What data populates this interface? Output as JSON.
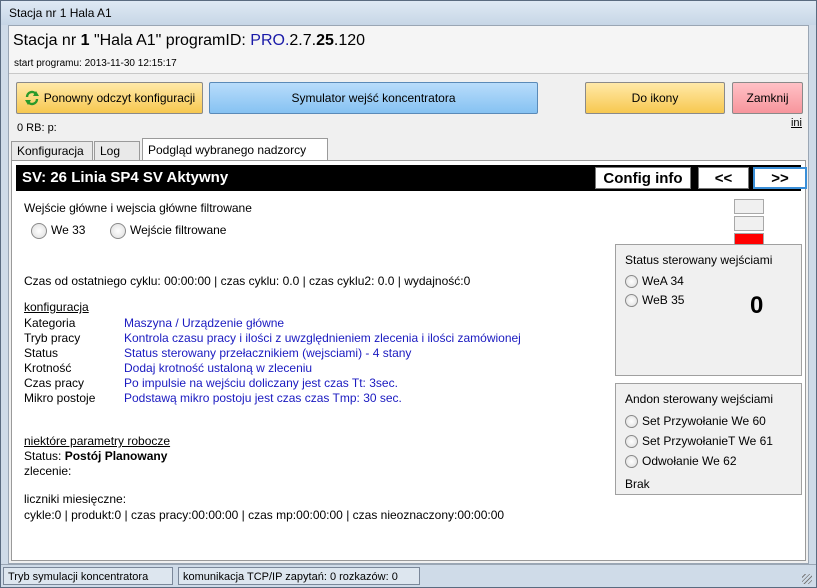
{
  "window": {
    "title": "Stacja nr 1   Hala A1"
  },
  "header": {
    "stacja_prefix": "Stacja nr ",
    "stacja_num": "1",
    "hala": "  \"Hala A1\"   programID: ",
    "pro": "PRO.",
    "ver1": "2.7.",
    "ver2": "25",
    "ver3": ".120",
    "start": "start programu: 2013-11-30 12:15:17"
  },
  "buttons": {
    "reload": "Ponowny odczyt konfiguracji",
    "simulator": "Symulator wejść koncentratora",
    "to_icon": "Do ikony",
    "close": "Zamknij"
  },
  "rb_line": "0   RB:  p:",
  "ini_link": "ini",
  "tabs": [
    "Konfiguracja",
    "Log",
    "Podgląd wybranego nadzorcy"
  ],
  "sv": {
    "title": "SV: 26 Linia SP4   SV Aktywny",
    "config_info": "Config info",
    "prev": "<<",
    "next": ">>"
  },
  "inputs": {
    "heading": "Wejście główne i wejscia główne filtrowane",
    "we": "We 33",
    "filtered": "Wejście filtrowane"
  },
  "indicators": {
    "colors": [
      "#f0f0f0",
      "#f0f0f0",
      "#ff0000"
    ]
  },
  "cycle_line": "Czas od ostatniego cyklu: 00:00:00 | czas cyklu: 0.0 | czas cyklu2: 0.0  |  wydajność:0",
  "konfiguracja": {
    "heading": "konfiguracja",
    "rows": [
      {
        "label": "Kategoria",
        "value": "Maszyna / Urządzenie główne"
      },
      {
        "label": "Tryb pracy",
        "value": "Kontrola czasu pracy i ilości z uwzględnieniem  zlecenia i ilości zamówionej"
      },
      {
        "label": "Status",
        "value": "Status sterowany przełacznikiem (wejsciami) - 4 stany"
      },
      {
        "label": "Krotność",
        "value": "Dodaj krotność ustaloną w zleceniu"
      },
      {
        "label": "Czas pracy",
        "value": "Po impulsie na wejściu doliczany jest czas Tt: 3sec."
      },
      {
        "label": "Mikro postoje",
        "value": "Podstawą mikro postoju jest czas czas Tmp: 30 sec."
      }
    ]
  },
  "params": {
    "heading": "niektóre parametry robocze",
    "status_label": "Status: ",
    "status_value": "Postój Planowany",
    "zlecenie": "zlecenie:"
  },
  "liczniki": {
    "heading": "liczniki miesięczne:",
    "line": "cykle:0  |  produkt:0  |  czas pracy:00:00:00  |  czas mp:00:00:00  |  czas nieoznaczony:00:00:00"
  },
  "status_group": {
    "title": "Status sterowany wejściami",
    "a": "WeA 34",
    "b": "WeB 35",
    "value": "0"
  },
  "andon_group": {
    "title": "Andon sterowany wejściami",
    "set1": "Set Przywołanie We 60",
    "set2": "Set PrzywołanieT We 61",
    "cancel": "Odwołanie We 62",
    "brak": "Brak"
  },
  "statusbar": {
    "mode": "Tryb symulacji koncentratora",
    "tcp": "komunikacja TCP/IP zapytań: 0  rozkazów: 0"
  }
}
